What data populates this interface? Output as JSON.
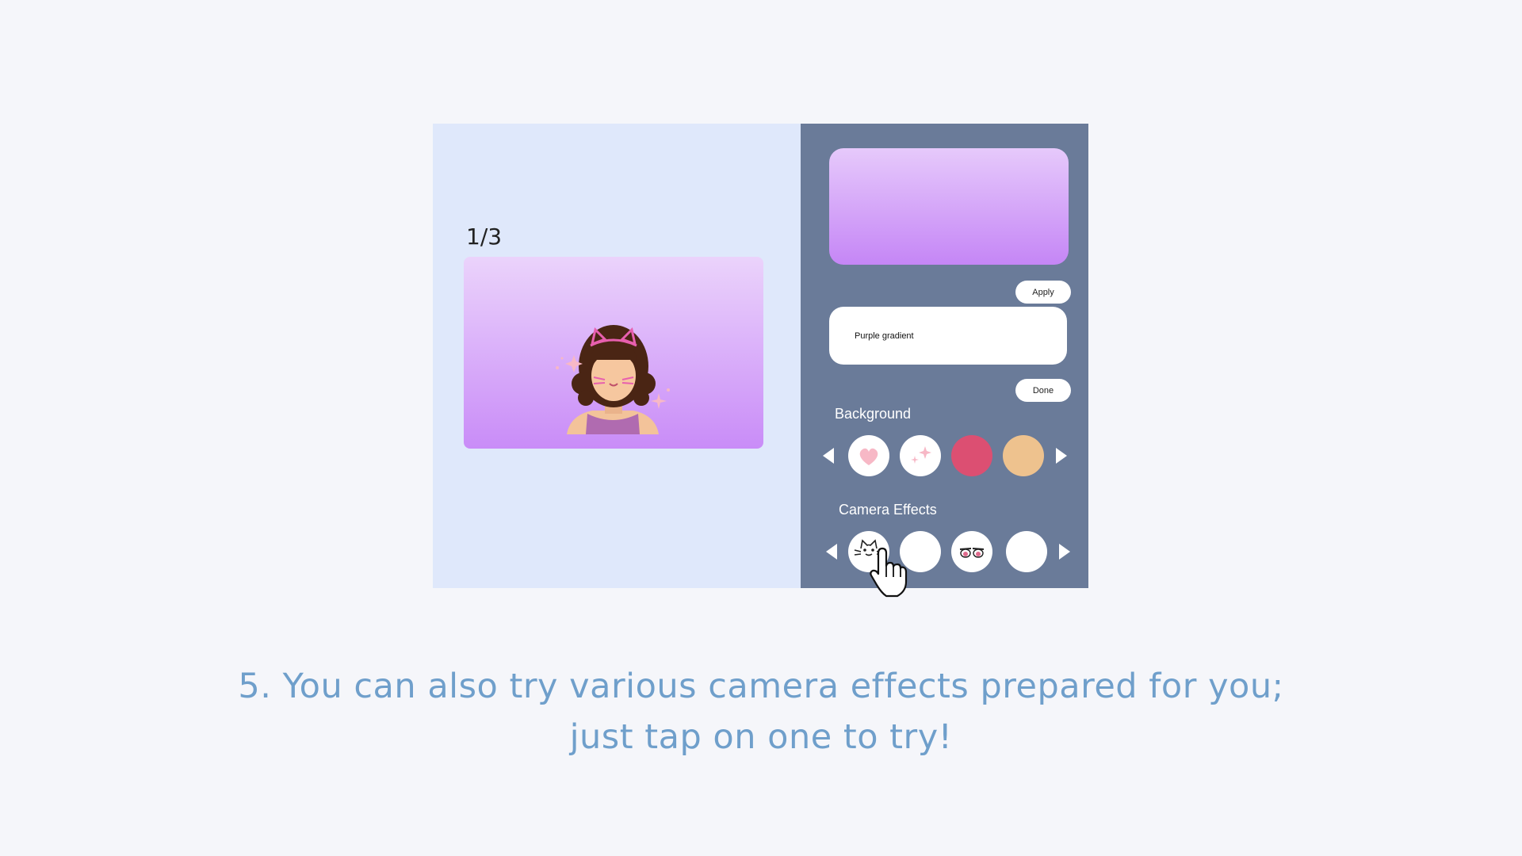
{
  "left": {
    "page_counter": "1/3"
  },
  "right": {
    "apply_label": "Apply",
    "name_input_value": "Purple gradient",
    "done_label": "Done",
    "background": {
      "label": "Background",
      "options": [
        {
          "name": "pink-heart",
          "color": "#ffffff"
        },
        {
          "name": "sparkles",
          "color": "#ffffff"
        },
        {
          "name": "pink",
          "color": "#dc4f72"
        },
        {
          "name": "peach",
          "color": "#eec28e"
        }
      ]
    },
    "camera_effects": {
      "label": "Camera Effects",
      "options": [
        {
          "name": "cat-face"
        },
        {
          "name": "blank"
        },
        {
          "name": "sparkle-eyes"
        },
        {
          "name": "blank"
        }
      ]
    }
  },
  "caption": {
    "line1": "5. You can also try various camera effects prepared for you;",
    "line2": "just tap on one to try!"
  },
  "colors": {
    "left_bg": "#dfe8fb",
    "right_bg": "#6a7b99",
    "caption": "#6f9fcb",
    "gradient_top": "#e6c9fb",
    "gradient_bottom": "#c586f6"
  }
}
